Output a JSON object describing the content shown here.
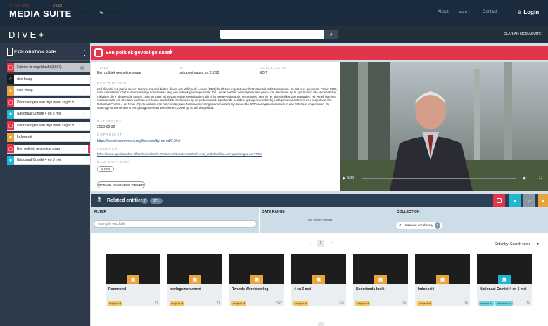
{
  "topbar": {
    "brand_small": "CLARIAH",
    "version": "V4.10",
    "brand": "MEDIA SUITE",
    "nav_data": "Data",
    "nav_tools": "Tools",
    "about": "About",
    "learn": "Learn",
    "contact": "Contact",
    "login": "Login"
  },
  "dive": {
    "logo": "DIVE+",
    "search_placeholder": "",
    "clariah_label": "CLARIAH MEDIASUITE"
  },
  "sidebar": {
    "title": "EXPLORATION PATH",
    "items": [
      {
        "label": "Fabriek in vogelvlucht (1937)",
        "icon": "record-icon",
        "color": "#e3354a",
        "badge": "1"
      },
      {
        "label": "den haag",
        "icon": "search-icon",
        "color": "#1b1b1b",
        "badge": ""
      },
      {
        "label": "Den Haag",
        "icon": "location-icon",
        "color": "#e8a43a",
        "badge": ""
      },
      {
        "label": "Door de ogen van mijn zoon zag ik h...",
        "icon": "record-icon",
        "color": "#e3354a",
        "badge": ""
      },
      {
        "label": "Nationaal Comité 4 en 5 mei",
        "icon": "person-icon",
        "color": "#1fb7d2",
        "badge": ""
      },
      {
        "label": "Door de ogen van mijn zoon zag ik h...",
        "icon": "record-icon",
        "color": "#e3354a",
        "badge": ""
      },
      {
        "label": "Indonesië",
        "icon": "location-icon",
        "color": "#e8a43a",
        "badge": ""
      },
      {
        "label": "Een politiek gevoelige snaar",
        "icon": "record-icon",
        "color": "#e3354a",
        "badge": ""
      },
      {
        "label": "Nationaal Comité 4 en 5 mei",
        "icon": "person-icon",
        "color": "#1fb7d2",
        "badge": ""
      }
    ]
  },
  "record": {
    "title": "Een politiek gevoelige snaar",
    "title_label": "TITLE",
    "title_value": "Een politiek gevoelige snaar",
    "id_label": "ID",
    "id_value": "oai:openimages.eu:21092",
    "collection_label": "COLLECTION",
    "collection_value": "EDIT",
    "description_label": "DESCRIPTION",
    "description": "Zelf diem hij 2,5 jaar in Nieuw-Guinea. Kolonel buiten dienst Jan Willem de Leeuw (1933) heeft zich ingezet voor het Nationaal Indië Monument. En dat is er gekomen. Pas in 1988, want de militaire inzet in de voormalige kolonie was lang een politiek gevoelige snaar. De Leeuw heeft er een dagtaak aan gehad om de namen op te sporen van alle Nederlandse militairen die in de periode tussen 1945 en 1962 in het voormalige Nederlands-Indië of in Nieuw-Guinea zijn gesneuveld. Het zijn er uiteindelijk 6.200 geworden. Hij vertelt hoe het mensen raakt om de naam van hun overleden familielid te herkennen op de gedenkwand. Sprekende beelden: getuigenverhalen bij oorlogsmonumenten! is een project van het Nationaal Comité 4 en 5 mei. Op de website van het comité (www.4en5mei.nl/oorlogsmonumenten) zijn meer dan 3000 oorlogsmonumenten in een database opgenomen. Bij sommige monumenten is een getuigenverhaal verschenen, zowel op schrift als gefilmd.",
    "datestart_label": "DATESTART",
    "datestart": "2010-02-22",
    "copyright_label": "COPYRIGHT",
    "copyright": "https://creativecommons.org/licenses/by-no-nd/3.0/nl/",
    "sources_label": "SOURCES",
    "sources": "https://www.openbeelden.nl/feeds/oai/?verb=GetRecord&metadataPrefix=oai_dc&identifier=oai:openimages.eu:21092",
    "raw_label": "RAW METADATA",
    "show_button": "SHOW",
    "open_button": "OPEN IN RESOURCE VIEWER"
  },
  "video": {
    "time": "0:00"
  },
  "related": {
    "title": "Related entities",
    "count_badge": "7",
    "count_badge2": "171"
  },
  "filters": {
    "filter_label": "FILTER",
    "filter_placeholder": "example -exclude",
    "date_label": "DATE RANGE",
    "date_value": "No dates found",
    "collection_label": "COLLECTION",
    "collection_chip": "Unknown vocabulary",
    "collection_count": "7"
  },
  "pagination": {
    "prev": "‹",
    "page": "1",
    "next": "›",
    "order_label": "Order by",
    "order_value": "Search score"
  },
  "cards": [
    {
      "title": "Roermond",
      "tag": "subject of",
      "tag2": "",
      "count": "1",
      "icon": "location-icon"
    },
    {
      "title": "oorlogsmonument",
      "tag": "subject of",
      "tag2": "",
      "count": "3",
      "icon": "location-icon"
    },
    {
      "title": "Tweede Wereldoorlog",
      "tag": "subject of",
      "tag2": "",
      "count": "127",
      "icon": "location-icon"
    },
    {
      "title": "4 en 5 mei",
      "tag": "subject of",
      "tag2": "",
      "count": "20",
      "icon": "location-icon"
    },
    {
      "title": "Nederlands-Indië",
      "tag": "subject of",
      "tag2": "",
      "count": "4",
      "icon": "location-icon"
    },
    {
      "title": "Indonesië",
      "tag": "subject of",
      "tag2": "",
      "count": "5",
      "icon": "location-icon"
    },
    {
      "title": "Nationaal Comité 4 en 5 mei",
      "tag": "creator of",
      "tag2": "publisher of",
      "count": "1",
      "icon": "person-icon"
    }
  ]
}
